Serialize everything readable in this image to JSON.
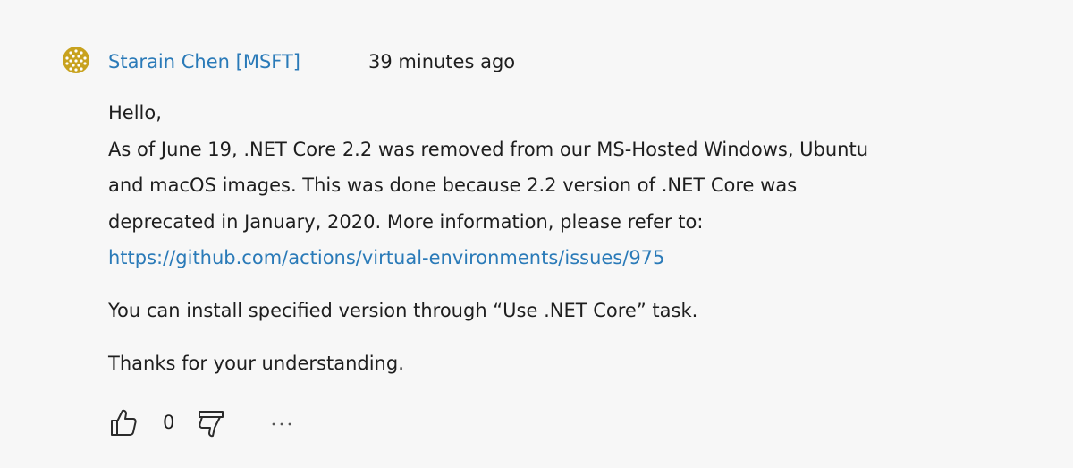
{
  "comment": {
    "author": "Starain Chen [MSFT]",
    "timestamp": "39 minutes ago",
    "body": {
      "greeting": "Hello,",
      "line1": "As of June 19, .NET Core 2.2 was removed from our MS-Hosted Windows, Ubuntu",
      "line2": "and macOS images. This was done because 2.2 version of .NET Core was",
      "line3": "deprecated in January, 2020. More information, please refer to:",
      "link": "https://github.com/actions/virtual-environments/issues/975",
      "paragraph2": "You can install specified version through “Use .NET Core” task.",
      "paragraph3": "Thanks for your understanding."
    },
    "actions": {
      "like_icon": "thumbs-up-icon",
      "vote_count": "0",
      "dislike_icon": "thumbs-down-icon",
      "more_icon": "more-options-icon"
    }
  },
  "colors": {
    "background": "#f7f7f7",
    "link": "#2a7ab8",
    "text": "#1e1e1e",
    "avatar": "#c8a21e"
  }
}
